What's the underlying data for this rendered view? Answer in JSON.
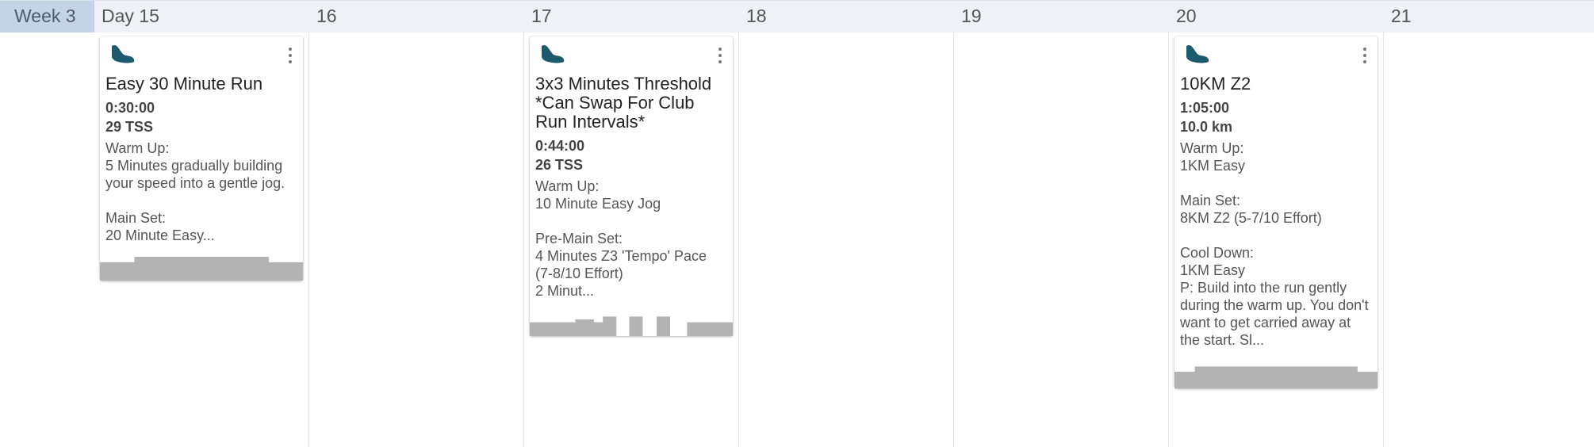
{
  "header": {
    "week_label": "Week 3",
    "days": [
      "Day 15",
      "16",
      "17",
      "18",
      "19",
      "20",
      "21"
    ]
  },
  "workouts": [
    {
      "icon": "running-shoe-icon",
      "title": "Easy 30 Minute Run",
      "duration": "0:30:00",
      "metric": "29 TSS",
      "description": "Warm Up:\n5 Minutes gradually building your speed into a gentle jog.\n\nMain Set:\n20 Minute Easy...",
      "profile": [
        {
          "w": 0.17,
          "h": 0.77
        },
        {
          "w": 0.66,
          "h": 1.0
        },
        {
          "w": 0.17,
          "h": 0.77
        }
      ]
    },
    {
      "icon": "running-shoe-icon",
      "title": "3x3 Minutes Threshold *Can Swap For Club Run Intervals*",
      "duration": "0:44:00",
      "metric": "26 TSS",
      "description": "Warm Up:\n10 Minute Easy Jog\n\nPre-Main Set:\n4 Minutes Z3 'Tempo' Pace (7-8/10 Effort)\n2 Minut...",
      "profile": [
        {
          "w": 0.225,
          "h": 0.58
        },
        {
          "w": 0.09,
          "h": 0.7
        },
        {
          "w": 0.045,
          "h": 0.58
        },
        {
          "w": 0.065,
          "h": 0.82
        },
        {
          "w": 0.065,
          "h": 0.0
        },
        {
          "w": 0.065,
          "h": 0.82
        },
        {
          "w": 0.07,
          "h": 0.0
        },
        {
          "w": 0.065,
          "h": 0.82
        },
        {
          "w": 0.085,
          "h": 0.0
        },
        {
          "w": 0.225,
          "h": 0.58
        }
      ]
    },
    {
      "icon": "running-shoe-icon",
      "title": "10KM Z2",
      "duration": "1:05:00",
      "metric": "10.0 km",
      "description": "Warm Up:\n1KM Easy\n\nMain Set:\n8KM Z2 (5-7/10 Effort)\n\nCool Down:\n1KM Easy\nP: Build into the run gently during the warm up. You don't want to get carried away at the start. Sl...",
      "profile": [
        {
          "w": 0.1,
          "h": 0.7
        },
        {
          "w": 0.8,
          "h": 0.92
        },
        {
          "w": 0.1,
          "h": 0.7
        }
      ]
    }
  ]
}
